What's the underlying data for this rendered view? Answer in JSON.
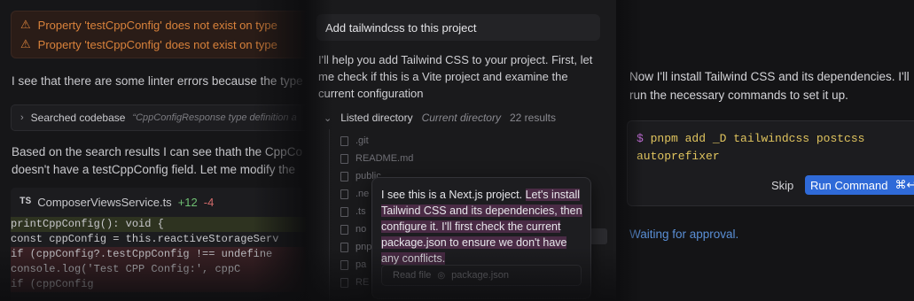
{
  "panel1": {
    "errors": [
      {
        "icon": "warning-icon",
        "text": "Property 'testCppConfig' does not exist on type"
      },
      {
        "icon": "warning-icon",
        "text": "Property 'testCppConfig' does not exist on type"
      }
    ],
    "linter_text": "I see that there are some linter errors because the type",
    "search": {
      "label": "Searched codebase",
      "query": "“CppConfigResponse type definition a"
    },
    "paragraph_line1": "Based on the search results I can see thath the CppCo",
    "paragraph_line2": "doesn't have a testCppConfig field. Let me modify the",
    "file": {
      "lang": "TS",
      "name": "ComposerViewsService.ts",
      "added": "+12",
      "removed": "-4"
    },
    "code_lines": [
      "  printCppConfig(): void {",
      "    const cppConfig = this.reactiveStorageServ",
      "    if (cppConfig?.testCppConfig !== undefine",
      "      console.log('Test CPP Config:', cppC",
      "    if (cppConfig"
    ]
  },
  "panel2": {
    "user_message": "Add tailwindcss to this project",
    "response": "I'll help you add Tailwind CSS to your project. First, let me check if this is a Vite project and examine the current configuration",
    "listed": {
      "label": "Listed directory",
      "dir": "Current directory",
      "count": "22 results"
    },
    "tree_items": [
      ".git",
      "README.md",
      "public",
      ".ne",
      ".ts",
      "no",
      "pnp",
      "pa",
      "RE"
    ],
    "popup": {
      "plain": "I see this is a Next.js project. ",
      "highlighted": "Let's install Tailwind CSS and its dependencies, then configure it. I'll first check the current package.json to ensure we don't have any conflicts.",
      "read_label": "Read file",
      "read_file": "package.json"
    }
  },
  "panel3": {
    "text": "Now I'll install Tailwind CSS and its dependencies. I'll run the necessary commands to set it up.",
    "prompt": "$",
    "command": "pnpm add _D tailwindcss postcss autoprefixer",
    "skip_label": "Skip",
    "run_label": "Run Command",
    "run_shortcut": "⌘↩",
    "status": "Waiting for approval."
  },
  "colors": {
    "accent_blue": "#2f6ad8",
    "warning": "#d9823b",
    "status_blue": "#5a8fd6",
    "highlight": "#4a2b45"
  }
}
